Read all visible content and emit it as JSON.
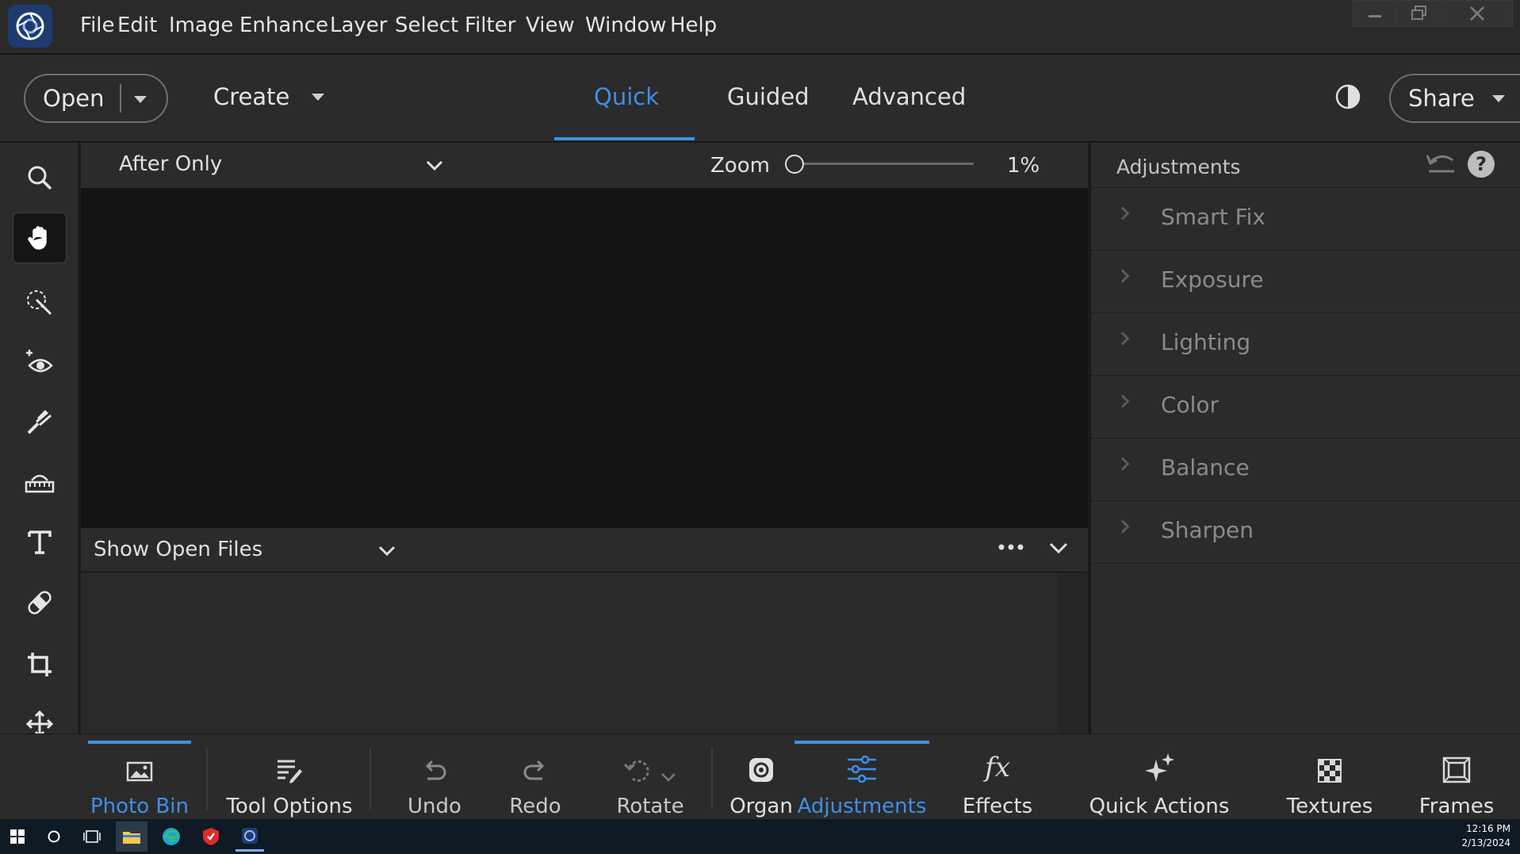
{
  "menu": {
    "items": [
      "File",
      "Edit",
      "Image",
      "Enhance",
      "Layer",
      "Select",
      "Filter",
      "View",
      "Window",
      "Help"
    ]
  },
  "window_controls": {
    "minimize_icon": "minimize-icon",
    "restore_icon": "restore-icon",
    "close_icon": "close-icon"
  },
  "modebar": {
    "open_label": "Open",
    "create_label": "Create",
    "tabs": [
      "Quick",
      "Guided",
      "Advanced"
    ],
    "active_tab": "Quick",
    "share_label": "Share"
  },
  "view": {
    "view_mode": "After Only",
    "zoom_label": "Zoom",
    "zoom_value": "1%",
    "zoom_fraction": 0.0
  },
  "photo_bin": {
    "source_label": "Show Open Files"
  },
  "adjustments_panel": {
    "title": "Adjustments",
    "items": [
      "Smart Fix",
      "Exposure",
      "Lighting",
      "Color",
      "Balance",
      "Sharpen"
    ]
  },
  "tools": [
    {
      "name": "zoom-tool",
      "icon": "search-icon",
      "active": false
    },
    {
      "name": "hand-tool",
      "icon": "hand-icon",
      "active": true
    },
    {
      "name": "quick-selection-tool",
      "icon": "magic-wand-icon",
      "active": false
    },
    {
      "name": "red-eye-tool",
      "icon": "eye-icon",
      "active": false
    },
    {
      "name": "whiten-teeth-tool",
      "icon": "brush-icon",
      "active": false
    },
    {
      "name": "straighten-tool",
      "icon": "straighten-icon",
      "active": false
    },
    {
      "name": "type-tool",
      "icon": "text-icon",
      "active": false
    },
    {
      "name": "spot-healing-tool",
      "icon": "bandage-icon",
      "active": false
    },
    {
      "name": "crop-tool",
      "icon": "crop-icon",
      "active": false
    },
    {
      "name": "move-tool",
      "icon": "move-icon",
      "active": false
    }
  ],
  "bottombar": {
    "photo_bin": "Photo Bin",
    "tool_options": "Tool Options",
    "undo": "Undo",
    "redo": "Redo",
    "rotate": "Rotate",
    "organizer": "Organ",
    "adjustments": "Adjustments",
    "effects": "Effects",
    "quick_actions": "Quick Actions",
    "textures": "Textures",
    "frames": "Frames"
  },
  "taskbar": {
    "time": "12:16 PM",
    "date": "2/13/2024"
  },
  "colors": {
    "accent": "#3f8fe6",
    "background": "#2b2b2b",
    "canvas": "#141414"
  }
}
